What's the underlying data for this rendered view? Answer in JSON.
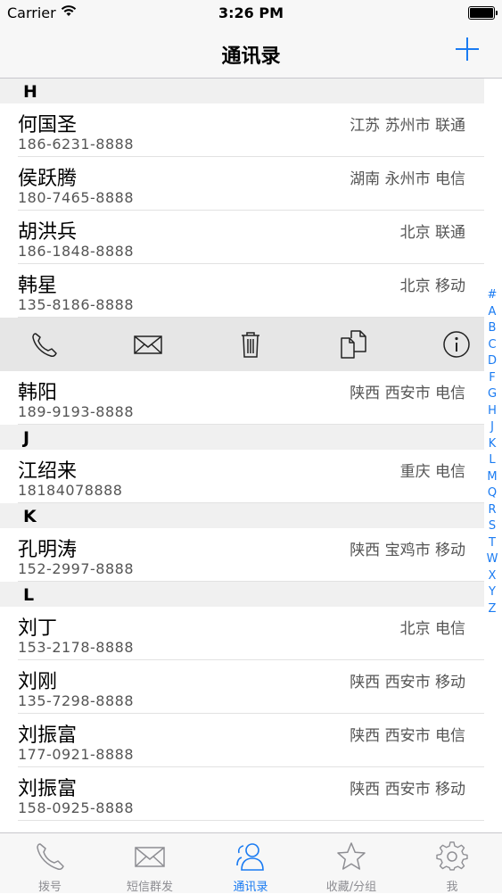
{
  "status_bar": {
    "carrier": "Carrier",
    "time": "3:26 PM"
  },
  "nav": {
    "title": "通讯录"
  },
  "sections": [
    {
      "letter": "H",
      "contacts": [
        {
          "name": "何国圣",
          "phone": "186-6231-8888",
          "location": "江苏 苏州市 联通"
        },
        {
          "name": "侯跃腾",
          "phone": "180-7465-8888",
          "location": "湖南 永州市 电信"
        },
        {
          "name": "胡洪兵",
          "phone": "186-1848-8888",
          "location": "北京 联通"
        },
        {
          "name": "韩星",
          "phone": "135-8186-8888",
          "location": "北京 移动"
        },
        {
          "name": "韩阳",
          "phone": "189-9193-8888",
          "location": "陕西 西安市 电信"
        }
      ]
    },
    {
      "letter": "J",
      "contacts": [
        {
          "name": "江绍来",
          "phone": "18184078888",
          "location": "重庆 电信"
        }
      ]
    },
    {
      "letter": "K",
      "contacts": [
        {
          "name": "孔明涛",
          "phone": "152-2997-8888",
          "location": "陕西 宝鸡市 移动"
        }
      ]
    },
    {
      "letter": "L",
      "contacts": [
        {
          "name": "刘丁",
          "phone": "153-2178-8888",
          "location": "北京 电信"
        },
        {
          "name": "刘刚",
          "phone": "135-7298-8888",
          "location": "陕西 西安市 移动"
        },
        {
          "name": "刘振富",
          "phone": "177-0921-8888",
          "location": "陕西 西安市 电信"
        },
        {
          "name": "刘振富",
          "phone": "158-0925-8888",
          "location": "陕西 西安市 移动"
        }
      ]
    }
  ],
  "action_bar_icons": [
    "phone-icon",
    "envelope-icon",
    "trash-icon",
    "copy-icon",
    "info-icon"
  ],
  "index_letters": [
    "#",
    "A",
    "B",
    "C",
    "D",
    "F",
    "G",
    "H",
    "J",
    "K",
    "L",
    "M",
    "Q",
    "R",
    "S",
    "T",
    "W",
    "X",
    "Y",
    "Z"
  ],
  "tabs": [
    {
      "label": "拨号",
      "icon": "phone-icon",
      "active": false
    },
    {
      "label": "短信群发",
      "icon": "envelope-icon",
      "active": false
    },
    {
      "label": "通讯录",
      "icon": "contacts-icon",
      "active": true
    },
    {
      "label": "收藏/分组",
      "icon": "star-icon",
      "active": false
    },
    {
      "label": "我",
      "icon": "gear-icon",
      "active": false
    }
  ],
  "colors": {
    "accent": "#1a7bf2",
    "section_bg": "#f0f0f0",
    "action_bar_bg": "#e6e6e6",
    "secondary_text": "#555555"
  }
}
